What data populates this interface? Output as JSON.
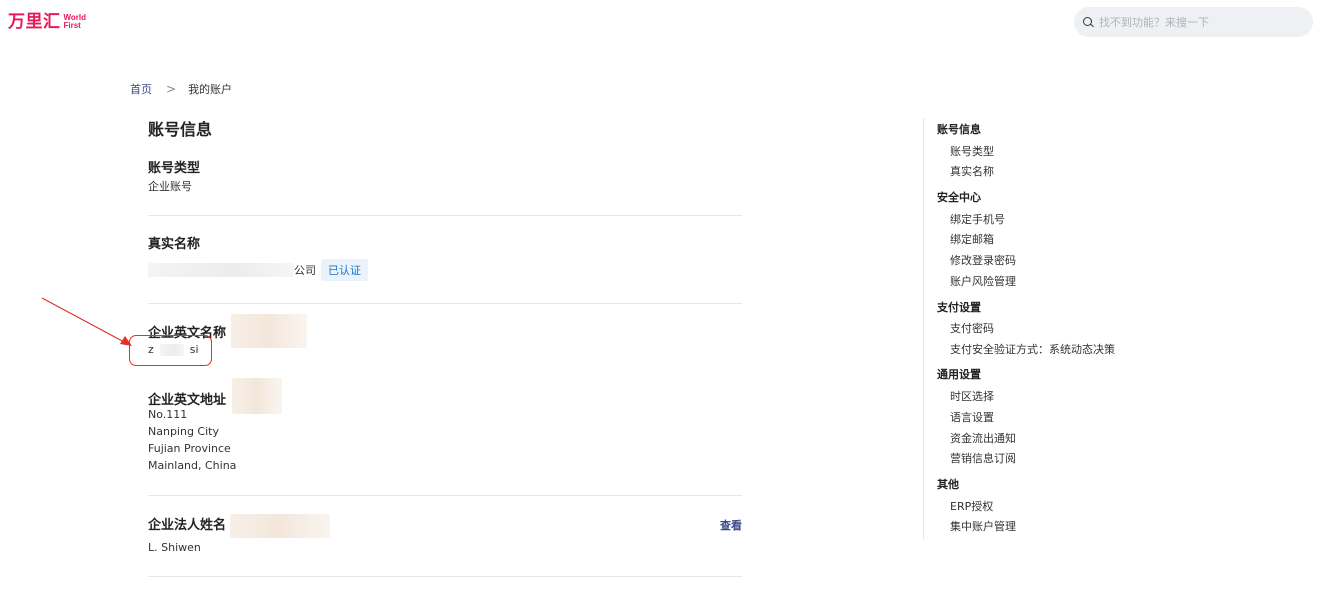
{
  "header": {
    "logo_cn": "万里汇",
    "logo_en_line1": "World",
    "logo_en_line2": "First",
    "search_placeholder": "找不到功能？来搜一下"
  },
  "breadcrumb": {
    "home": "首页",
    "separator": ">",
    "current": "我的账户"
  },
  "main": {
    "title": "账号信息",
    "account_type": {
      "label": "账号类型",
      "value": "企业账号"
    },
    "real_name": {
      "label": "真实名称",
      "value_suffix": "公司",
      "badge": "已认证"
    },
    "english_name": {
      "label": "企业英文名称",
      "value_start": "z",
      "value_end": "si"
    },
    "english_address": {
      "label": "企业英文地址",
      "lines": [
        "No.111",
        "Nanping City",
        "Fujian Province",
        "Mainland, China"
      ]
    },
    "legal_person": {
      "label": "企业法人姓名",
      "value": "L. Shiwen",
      "action": "查看"
    }
  },
  "sidebar": {
    "groups": [
      {
        "title": "账号信息",
        "items": [
          "账号类型",
          "真实名称"
        ]
      },
      {
        "title": "安全中心",
        "items": [
          "绑定手机号",
          "绑定邮箱",
          "修改登录密码",
          "账户风险管理"
        ]
      },
      {
        "title": "支付设置",
        "items": [
          "支付密码",
          "支付安全验证方式：系统动态决策"
        ]
      },
      {
        "title": "通用设置",
        "items": [
          "时区选择",
          "语言设置",
          "资金流出通知",
          "营销信息订阅"
        ]
      },
      {
        "title": "其他",
        "items": [
          "ERP授权",
          "集中账户管理"
        ]
      }
    ]
  },
  "colors": {
    "brand": "#e8195a",
    "link": "#3a4a8c",
    "badge_text": "#1a73c9",
    "badge_bg": "#eaf3fb",
    "annotation": "#e0312b"
  }
}
